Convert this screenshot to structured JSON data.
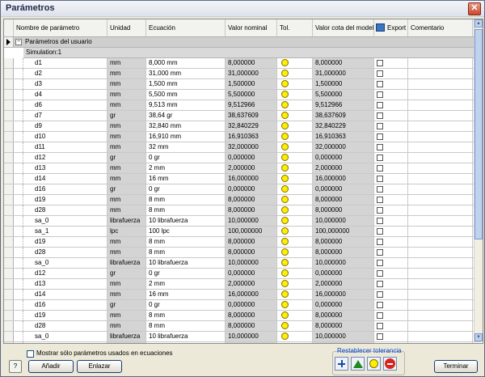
{
  "window": {
    "title": "Parámetros",
    "close_glyph": "✕"
  },
  "columns": [
    {
      "label": "Nombre de parámetro"
    },
    {
      "label": "Unidad"
    },
    {
      "label": "Ecuación"
    },
    {
      "label": "Valor nominal"
    },
    {
      "label": "Tol."
    },
    {
      "label": "Valor cota del modelo"
    },
    {
      "label": "Export"
    },
    {
      "label": "Comentario"
    }
  ],
  "group": {
    "label": "Parámetros del usuario",
    "toggle": "−"
  },
  "subgroup": {
    "label": "Simulation:1"
  },
  "rows": [
    {
      "name": "d1",
      "unit": "mm",
      "eq": "8,000 mm",
      "nominal": "8,000000",
      "model": "8,000000"
    },
    {
      "name": "d2",
      "unit": "mm",
      "eq": "31,000 mm",
      "nominal": "31,000000",
      "model": "31,000000"
    },
    {
      "name": "d3",
      "unit": "mm",
      "eq": "1,500 mm",
      "nominal": "1,500000",
      "model": "1,500000"
    },
    {
      "name": "d4",
      "unit": "mm",
      "eq": "5,500 mm",
      "nominal": "5,500000",
      "model": "5,500000"
    },
    {
      "name": "d6",
      "unit": "mm",
      "eq": "9,513 mm",
      "nominal": "9,512966",
      "model": "9,512966"
    },
    {
      "name": "d7",
      "unit": "gr",
      "eq": "38,64 gr",
      "nominal": "38,637609",
      "model": "38,637609"
    },
    {
      "name": "d9",
      "unit": "mm",
      "eq": "32,840 mm",
      "nominal": "32,840229",
      "model": "32,840229"
    },
    {
      "name": "d10",
      "unit": "mm",
      "eq": "16,910 mm",
      "nominal": "16,910363",
      "model": "16,910363"
    },
    {
      "name": "d11",
      "unit": "mm",
      "eq": "32 mm",
      "nominal": "32,000000",
      "model": "32,000000"
    },
    {
      "name": "d12",
      "unit": "gr",
      "eq": "0 gr",
      "nominal": "0,000000",
      "model": "0,000000"
    },
    {
      "name": "d13",
      "unit": "mm",
      "eq": "2 mm",
      "nominal": "2,000000",
      "model": "2,000000"
    },
    {
      "name": "d14",
      "unit": "mm",
      "eq": "16 mm",
      "nominal": "16,000000",
      "model": "16,000000"
    },
    {
      "name": "d16",
      "unit": "gr",
      "eq": "0 gr",
      "nominal": "0,000000",
      "model": "0,000000"
    },
    {
      "name": "d19",
      "unit": "mm",
      "eq": "8 mm",
      "nominal": "8,000000",
      "model": "8,000000"
    },
    {
      "name": "d28",
      "unit": "mm",
      "eq": "8 mm",
      "nominal": "8,000000",
      "model": "8,000000"
    },
    {
      "name": "sa_0",
      "unit": "librafuerza",
      "eq": "10 librafuerza",
      "nominal": "10,000000",
      "model": "10,000000"
    },
    {
      "name": "sa_1",
      "unit": "lpc",
      "eq": "100 lpc",
      "nominal": "100,000000",
      "model": "100,000000"
    },
    {
      "name": "d19",
      "unit": "mm",
      "eq": "8 mm",
      "nominal": "8,000000",
      "model": "8,000000"
    },
    {
      "name": "d28",
      "unit": "mm",
      "eq": "8 mm",
      "nominal": "8,000000",
      "model": "8,000000"
    },
    {
      "name": "sa_0",
      "unit": "librafuerza",
      "eq": "10 librafuerza",
      "nominal": "10,000000",
      "model": "10,000000"
    },
    {
      "name": "d12",
      "unit": "gr",
      "eq": "0 gr",
      "nominal": "0,000000",
      "model": "0,000000"
    },
    {
      "name": "d13",
      "unit": "mm",
      "eq": "2 mm",
      "nominal": "2,000000",
      "model": "2,000000"
    },
    {
      "name": "d14",
      "unit": "mm",
      "eq": "16 mm",
      "nominal": "16,000000",
      "model": "16,000000"
    },
    {
      "name": "d16",
      "unit": "gr",
      "eq": "0 gr",
      "nominal": "0,000000",
      "model": "0,000000"
    },
    {
      "name": "d19",
      "unit": "mm",
      "eq": "8 mm",
      "nominal": "8,000000",
      "model": "8,000000"
    },
    {
      "name": "d28",
      "unit": "mm",
      "eq": "8 mm",
      "nominal": "8,000000",
      "model": "8,000000"
    },
    {
      "name": "sa_0",
      "unit": "librafuerza",
      "eq": "10 librafuerza",
      "nominal": "10,000000",
      "model": "10,000000"
    },
    {
      "name": "sa_1",
      "unit": "librafuerza",
      "eq": "10 librafuerza",
      "nominal": "10,000000",
      "model": "10,000000"
    }
  ],
  "footer": {
    "only_used_label": "Mostrar sólo parámetros usados en ecuaciones",
    "help_label": "?",
    "add_label": "Añadir",
    "link_label": "Enlazar",
    "tolerance_label": "Restablecer tolerancia",
    "finish_label": "Terminar"
  },
  "colors": {
    "tol_indicator": "#ffef00",
    "tol_link": "#0046d5"
  }
}
